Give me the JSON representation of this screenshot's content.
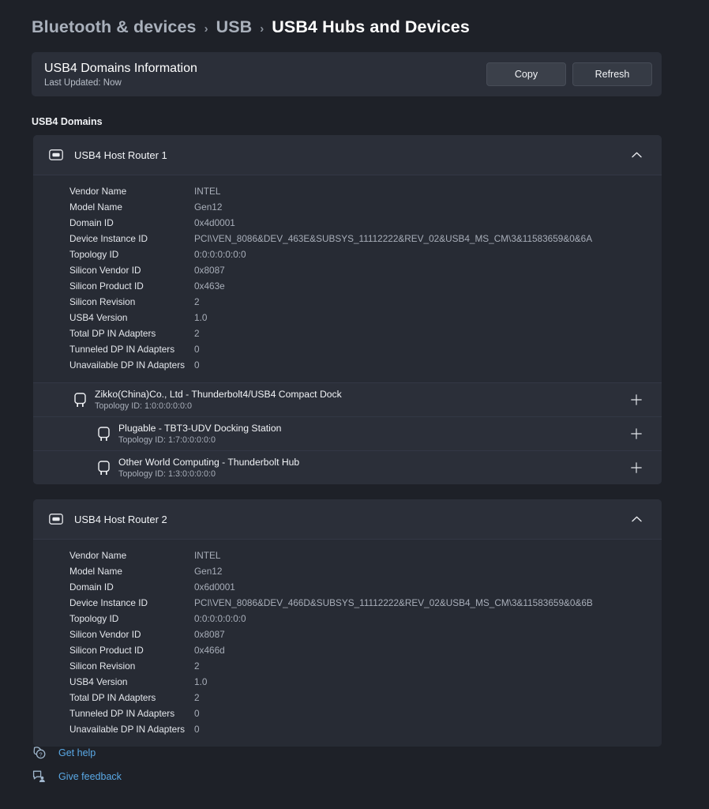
{
  "breadcrumb": {
    "items": [
      {
        "label": "Bluetooth & devices",
        "current": false
      },
      {
        "label": "USB",
        "current": false
      },
      {
        "label": "USB4 Hubs and Devices",
        "current": true
      }
    ],
    "separator": "›"
  },
  "info_bar": {
    "title": "USB4 Domains Information",
    "subtitle": "Last Updated:  Now",
    "copy_label": "Copy",
    "refresh_label": "Refresh"
  },
  "section": {
    "label": "USB4 Domains"
  },
  "routers": [
    {
      "title": "USB4 Host Router 1",
      "icon": "usb-port-icon",
      "expanded": true,
      "properties": [
        {
          "key": "Vendor Name",
          "value": "INTEL"
        },
        {
          "key": "Model Name",
          "value": "Gen12"
        },
        {
          "key": "Domain ID",
          "value": "0x4d0001"
        },
        {
          "key": "Device Instance ID",
          "value": "PCI\\VEN_8086&DEV_463E&SUBSYS_11112222&REV_02&USB4_MS_CM\\3&11583659&0&6A"
        },
        {
          "key": "Topology ID",
          "value": "0:0:0:0:0:0:0"
        },
        {
          "key": "Silicon Vendor ID",
          "value": "0x8087"
        },
        {
          "key": "Silicon Product ID",
          "value": "0x463e"
        },
        {
          "key": "Silicon Revision",
          "value": "2"
        },
        {
          "key": "USB4 Version",
          "value": "1.0"
        },
        {
          "key": "Total DP IN Adapters",
          "value": "2"
        },
        {
          "key": "Tunneled DP IN Adapters",
          "value": "0"
        },
        {
          "key": "Unavailable DP IN Adapters",
          "value": "0"
        }
      ],
      "children": [
        {
          "name": "Zikko(China)Co., Ltd - Thunderbolt4/USB4 Compact Dock",
          "topology": "Topology ID:  1:0:0:0:0:0:0",
          "level": 1,
          "icon": "usb-device-icon",
          "expand_label": "+"
        },
        {
          "name": "Plugable - TBT3-UDV Docking Station",
          "topology": "Topology ID:  1:7:0:0:0:0:0",
          "level": 2,
          "icon": "usb-device-icon",
          "expand_label": "+"
        },
        {
          "name": "Other World Computing - Thunderbolt Hub",
          "topology": "Topology ID:  1:3:0:0:0:0:0",
          "level": 2,
          "icon": "usb-device-icon",
          "expand_label": "+"
        }
      ]
    },
    {
      "title": "USB4 Host Router 2",
      "icon": "usb-port-icon",
      "expanded": true,
      "properties": [
        {
          "key": "Vendor Name",
          "value": "INTEL"
        },
        {
          "key": "Model Name",
          "value": "Gen12"
        },
        {
          "key": "Domain ID",
          "value": "0x6d0001"
        },
        {
          "key": "Device Instance ID",
          "value": "PCI\\VEN_8086&DEV_466D&SUBSYS_11112222&REV_02&USB4_MS_CM\\3&11583659&0&6B"
        },
        {
          "key": "Topology ID",
          "value": "0:0:0:0:0:0:0"
        },
        {
          "key": "Silicon Vendor ID",
          "value": "0x8087"
        },
        {
          "key": "Silicon Product ID",
          "value": "0x466d"
        },
        {
          "key": "Silicon Revision",
          "value": "2"
        },
        {
          "key": "USB4 Version",
          "value": "1.0"
        },
        {
          "key": "Total DP IN Adapters",
          "value": "2"
        },
        {
          "key": "Tunneled DP IN Adapters",
          "value": "0"
        },
        {
          "key": "Unavailable DP IN Adapters",
          "value": "0"
        }
      ],
      "children": []
    }
  ],
  "footer_links": [
    {
      "label": "Get help",
      "icon": "help-icon"
    },
    {
      "label": "Give feedback",
      "icon": "feedback-icon"
    }
  ],
  "colors": {
    "page_background": "#1e2128",
    "card_background": "#2b2f39",
    "props_background": "#272b34",
    "link_accent": "#5aa9e6",
    "primary_text": "#ffffff",
    "secondary_text": "#a8aeb9"
  }
}
